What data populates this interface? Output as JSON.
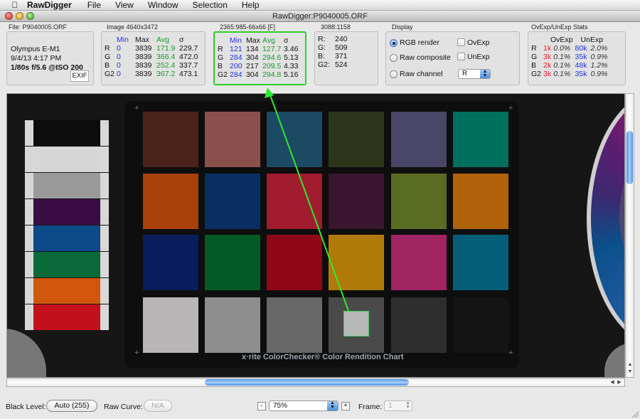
{
  "menubar": {
    "apple_icon": "apple-logo",
    "app_name": "RawDigger",
    "items": [
      "File",
      "View",
      "Window",
      "Selection",
      "Help"
    ]
  },
  "window": {
    "title": "RawDigger:P9040005.ORF"
  },
  "file_panel": {
    "label": "File: P9040005.ORF",
    "camera": "Olympus E-M1",
    "datetime": "9/4/13 4:17 PM",
    "exposure": "1/80s f/5.6 @ISO 200",
    "exif_button": "EXIF"
  },
  "image_panel": {
    "label": "Image 4640x3472",
    "headers": [
      "",
      "Min",
      "Max",
      "Avg",
      "σ"
    ],
    "rows": [
      {
        "ch": "R",
        "min": "0",
        "max": "3839",
        "avg": "171.9",
        "sd": "229.7"
      },
      {
        "ch": "G",
        "min": "0",
        "max": "3839",
        "avg": "366.4",
        "sd": "472.0"
      },
      {
        "ch": "B",
        "min": "0",
        "max": "3839",
        "avg": "252.4",
        "sd": "337.7"
      },
      {
        "ch": "G2",
        "min": "0",
        "max": "3839",
        "avg": "367.2",
        "sd": "473.1"
      }
    ]
  },
  "selection_panel": {
    "label": "2365:985-66x66 [F]",
    "headers": [
      "",
      "Min",
      "Max",
      "Avg",
      "σ"
    ],
    "rows": [
      {
        "ch": "R",
        "min": "121",
        "max": "134",
        "avg": "127.7",
        "sd": "3.46"
      },
      {
        "ch": "G",
        "min": "284",
        "max": "304",
        "avg": "294.6",
        "sd": "5.13"
      },
      {
        "ch": "B",
        "min": "200",
        "max": "217",
        "avg": "209.5",
        "sd": "4.33"
      },
      {
        "ch": "G2",
        "min": "284",
        "max": "304",
        "avg": "294.8",
        "sd": "5.16"
      }
    ],
    "highlight_color": "#2ad02a"
  },
  "pixel_panel": {
    "label": "3088:1158",
    "rows": [
      {
        "ch": "R:",
        "val": "240"
      },
      {
        "ch": "G:",
        "val": "509"
      },
      {
        "ch": "B:",
        "val": "371"
      },
      {
        "ch": "G2:",
        "val": "524"
      }
    ]
  },
  "display_panel": {
    "label": "Display",
    "radios": [
      {
        "label": "RGB render",
        "selected": true
      },
      {
        "label": "Raw composite",
        "selected": false
      },
      {
        "label": "Raw channel",
        "selected": false
      }
    ],
    "checkboxes": [
      {
        "label": "OvExp",
        "checked": false
      },
      {
        "label": "UnExp",
        "checked": false
      }
    ],
    "channel_select": "R"
  },
  "exp_panel": {
    "label": "OvExp/UnExp Stats",
    "headers": [
      "",
      "OvExp",
      "",
      "UnExp",
      ""
    ],
    "rows": [
      {
        "ch": "R",
        "ov": "1k",
        "ovp": "0.0%",
        "un": "80k",
        "unp": "2.0%"
      },
      {
        "ch": "G",
        "ov": "3k",
        "ovp": "0.1%",
        "un": "35k",
        "unp": "0.9%"
      },
      {
        "ch": "B",
        "ov": "2k",
        "ovp": "0.1%",
        "un": "48k",
        "unp": "1.2%"
      },
      {
        "ch": "G2",
        "ov": "3k",
        "ovp": "0.1%",
        "un": "35k",
        "unp": "0.9%"
      }
    ]
  },
  "image_view": {
    "caption": "x·rite ColorChecker® Color Rendition Chart",
    "patches": [
      [
        "#4a2219",
        "#8c504c",
        "#1c4a62",
        "#2c3519",
        "#4a4668",
        "#00705e"
      ],
      [
        "#a8400a",
        "#0a2e62",
        "#a01c2e",
        "#3a1630",
        "#5a6c22",
        "#b0620a"
      ],
      [
        "#0a1e5e",
        "#045a26",
        "#900818",
        "#b07a0a",
        "#a02462",
        "#045e7a"
      ],
      [
        "#b8b6b6",
        "#8e8e8e",
        "#686868",
        "#4a4a4a",
        "#2e2e2e",
        "#141414"
      ]
    ],
    "spools": [
      "#0c0c0c",
      "#d6d6d6",
      "#9a9a9a",
      "#3a0c44",
      "#0c4a8a",
      "#0a6a3a",
      "#d2560c",
      "#c4101a"
    ]
  },
  "scrollbars": {
    "vertical_position": 0.15,
    "horizontal_position": 0.33
  },
  "bottombar": {
    "black_level_label": "Black Level:",
    "black_level_value": "Auto (255)",
    "raw_curve_label": "Raw Curve:",
    "raw_curve_value": "N/A",
    "zoom_minus": "-",
    "zoom_value": "75%",
    "zoom_plus": "+",
    "frame_label": "Frame:",
    "frame_value": "1"
  }
}
